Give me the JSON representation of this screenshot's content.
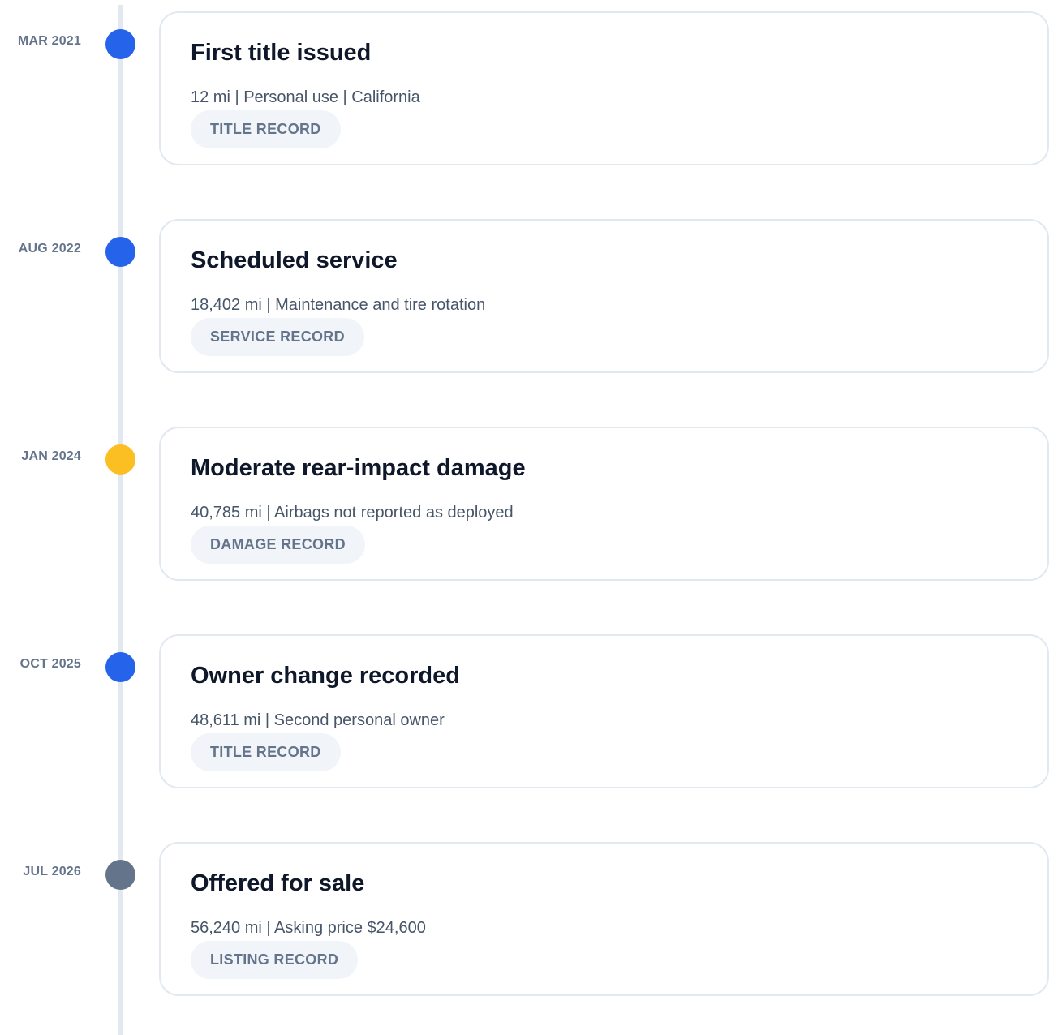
{
  "colors": {
    "rail": "#e2e8f0",
    "dot_blue": "#2563eb",
    "dot_amber": "#fbbf24",
    "dot_gray": "#64748b"
  },
  "events": [
    {
      "date": "MAR 2021",
      "dot_color": "#2563eb",
      "title": "First title issued",
      "detail": "12 mi | Personal use | California",
      "badge": "TITLE RECORD"
    },
    {
      "date": "AUG 2022",
      "dot_color": "#2563eb",
      "title": "Scheduled service",
      "detail": "18,402 mi | Maintenance and tire rotation",
      "badge": "SERVICE RECORD"
    },
    {
      "date": "JAN 2024",
      "dot_color": "#fbbf24",
      "title": "Moderate rear-impact damage",
      "detail": "40,785 mi | Airbags not reported as deployed",
      "badge": "DAMAGE RECORD"
    },
    {
      "date": "OCT 2025",
      "dot_color": "#2563eb",
      "title": "Owner change recorded",
      "detail": "48,611 mi | Second personal owner",
      "badge": "TITLE RECORD"
    },
    {
      "date": "JUL 2026",
      "dot_color": "#64748b",
      "title": "Offered for sale",
      "detail": "56,240 mi | Asking price $24,600",
      "badge": "LISTING RECORD"
    }
  ]
}
